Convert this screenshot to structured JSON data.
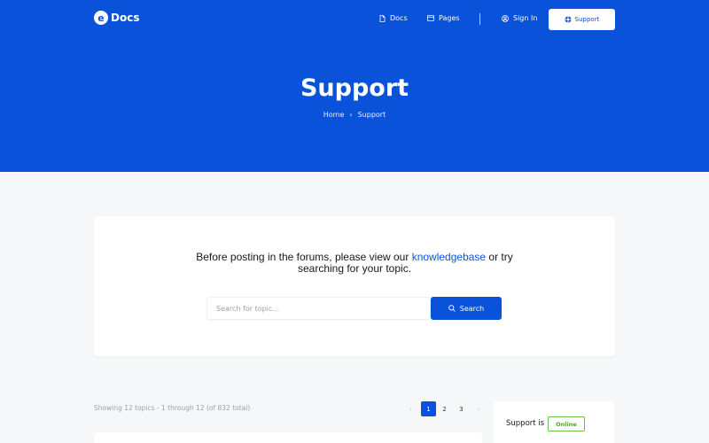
{
  "header": {
    "logo_letter": "e",
    "logo_text": "Docs",
    "nav": {
      "docs": "Docs",
      "pages": "Pages",
      "sign_in": "Sign In",
      "support_button": "Support"
    },
    "title": "Support",
    "breadcrumb": {
      "home": "Home",
      "separator": "›",
      "current": "Support"
    }
  },
  "search_card": {
    "intro_before": "Before posting in the forums, please view our ",
    "intro_link": "knowledgebase",
    "intro_after": " or try",
    "intro_line2": "searching for your topic.",
    "input_placeholder": "Search for topic...",
    "input_value": "",
    "button_label": "Search"
  },
  "topics": {
    "showing_text": "Showing 12 topics - 1 through 12 (of 832 total)",
    "pagination": {
      "prev": "‹",
      "pages": [
        "1",
        "2",
        "3"
      ],
      "current": "1",
      "next": "›"
    }
  },
  "support_status": {
    "label": "Support is",
    "badge": "Online"
  },
  "colors": {
    "brand_blue": "#0b52db",
    "online_green": "#6cc04a",
    "page_bg": "#f6f7f9"
  },
  "icons": {
    "docs": "document-icon",
    "pages": "pages-icon",
    "sign_in": "user-icon",
    "support": "lifebuoy-icon",
    "search": "search-icon"
  }
}
